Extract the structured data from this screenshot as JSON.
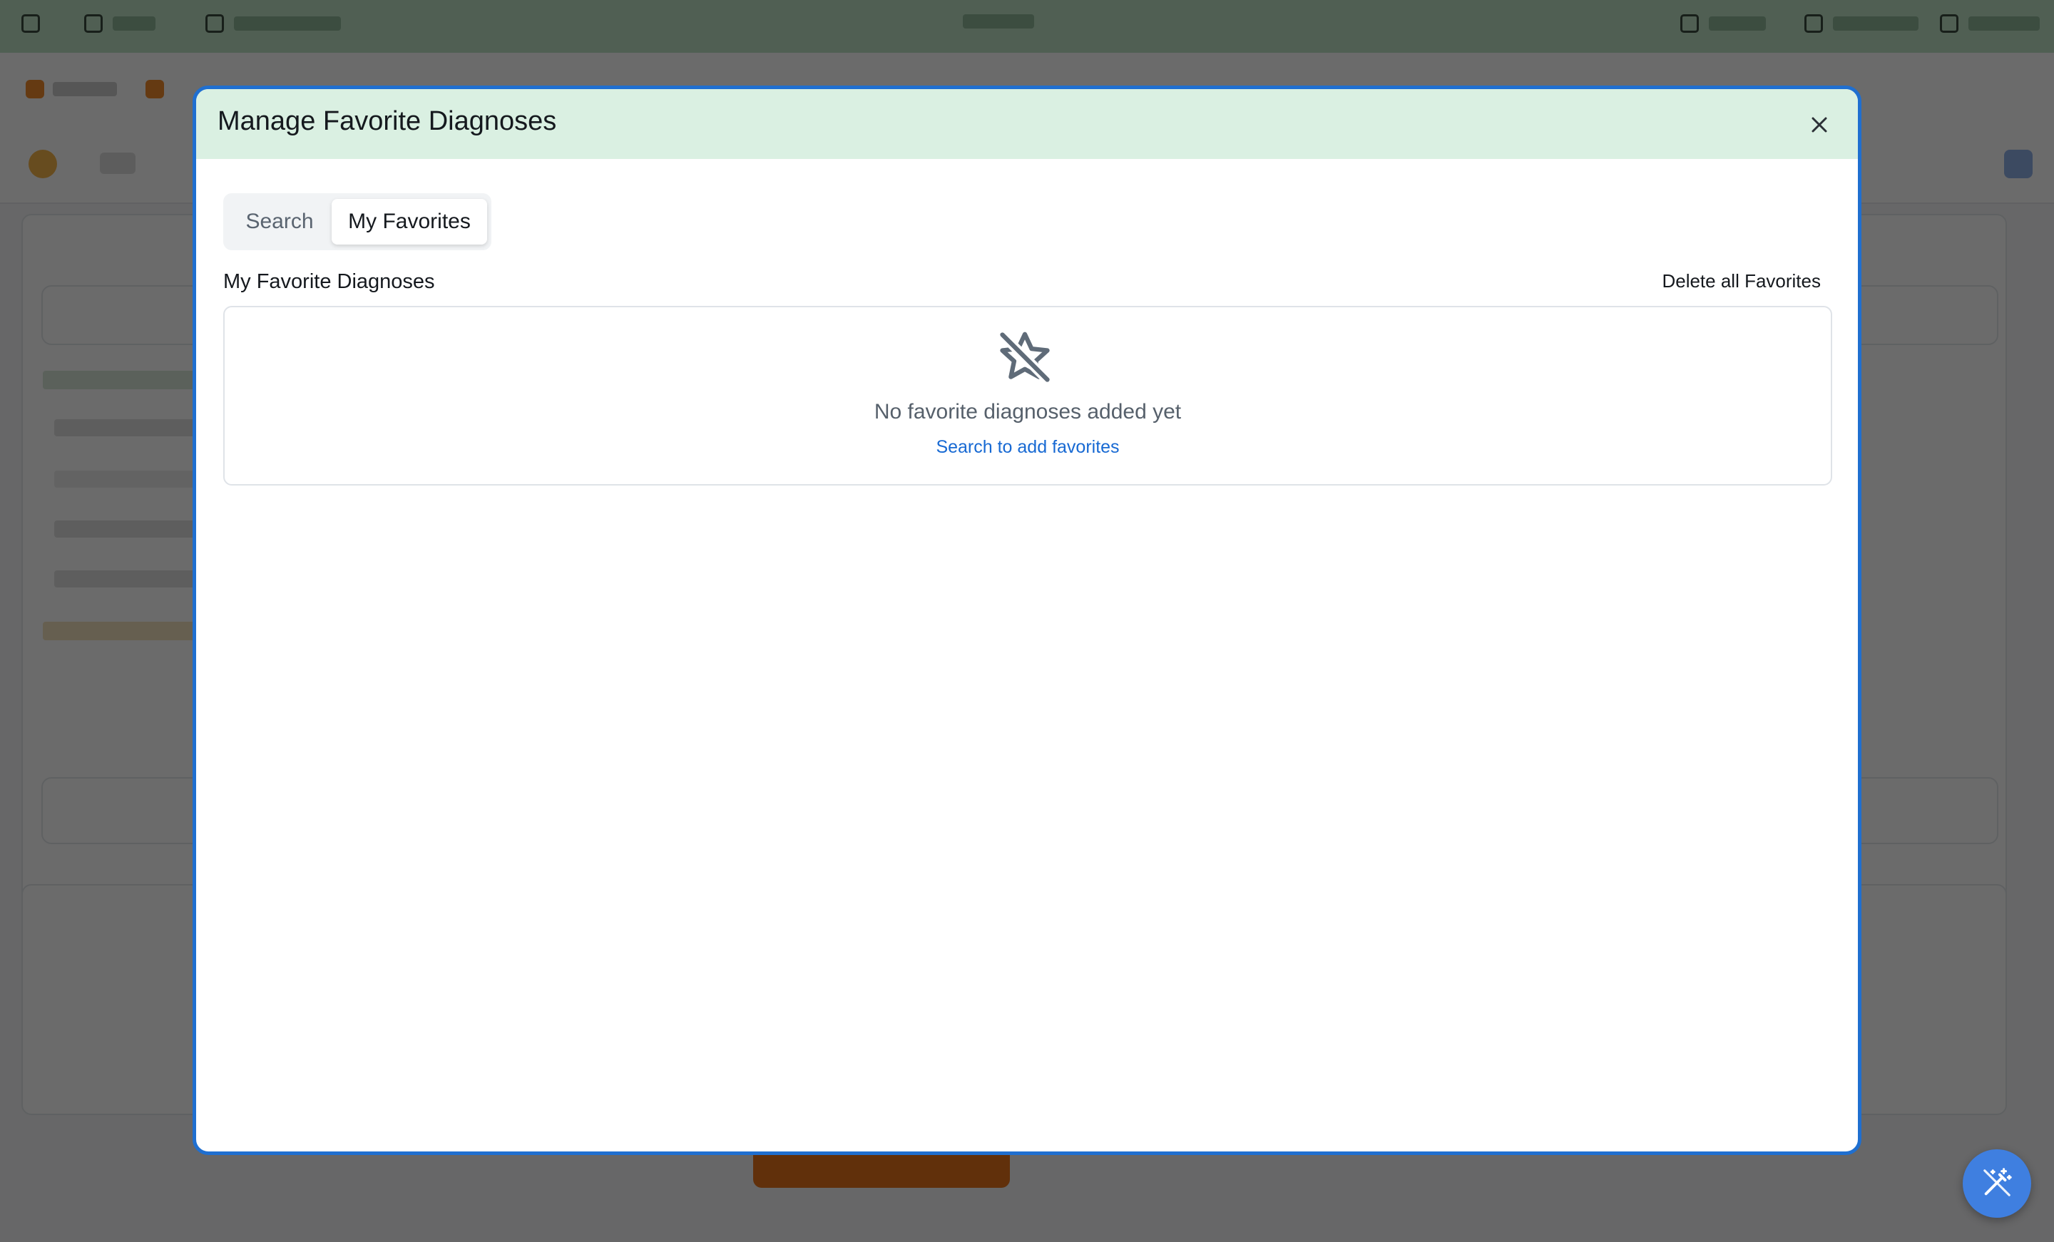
{
  "modal": {
    "title": "Manage Favorite Diagnoses",
    "tabs": [
      {
        "label": "Search",
        "active": false
      },
      {
        "label": "My Favorites",
        "active": true
      }
    ],
    "section_title": "My Favorite Diagnoses",
    "delete_all_label": "Delete all Favorites",
    "empty_state": {
      "icon": "star-off-icon",
      "message": "No favorite diagnoses added yet",
      "link": "Search to add favorites"
    }
  },
  "icons": {
    "close": "close-icon",
    "fab": "magic-wand-icon"
  },
  "colors": {
    "header_bg": "#daf0e2",
    "modal_border": "#1f6fd0",
    "link": "#1769d3",
    "fab": "#3f7fe0",
    "topbar": "#bfe3c6",
    "accent_orange": "#e7731c"
  }
}
